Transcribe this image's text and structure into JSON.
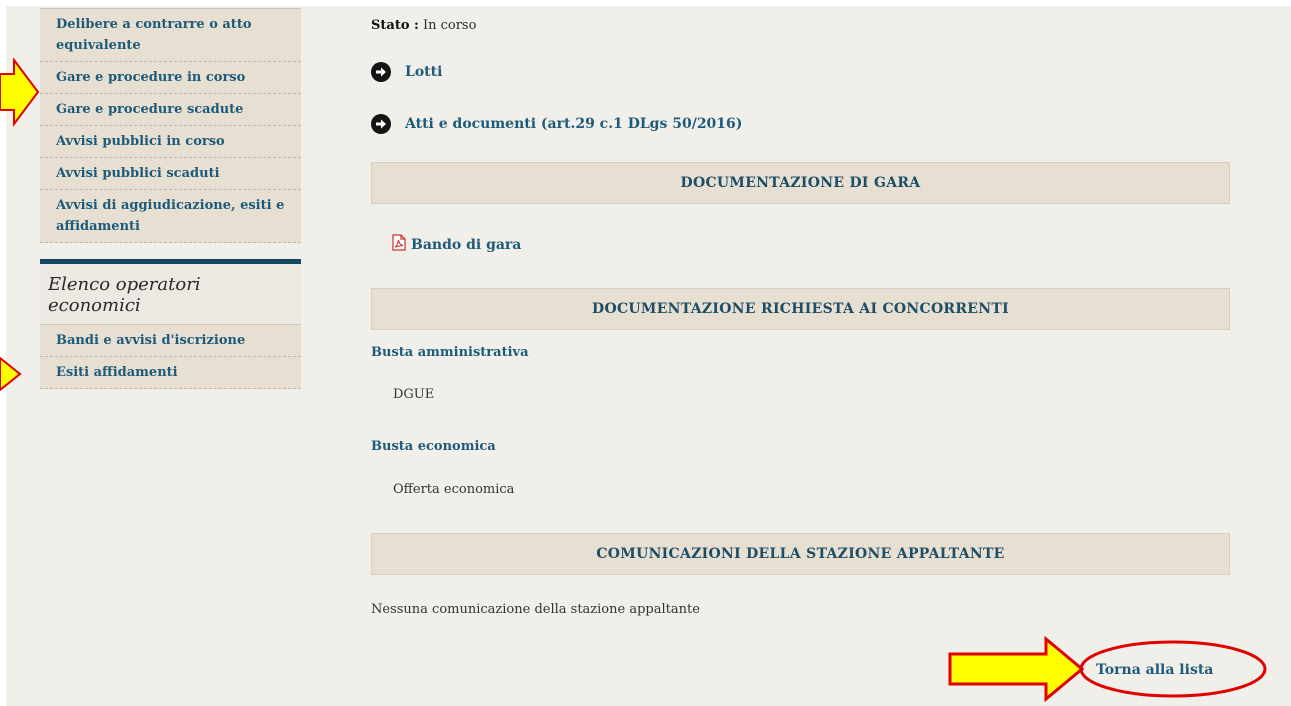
{
  "sidebar": {
    "items": [
      {
        "label": "Delibere a contrarre o atto equivalente"
      },
      {
        "label": "Gare e procedure in corso"
      },
      {
        "label": "Gare e procedure scadute"
      },
      {
        "label": "Avvisi pubblici in corso"
      },
      {
        "label": "Avvisi pubblici scaduti"
      },
      {
        "label": "Avvisi di aggiudicazione, esiti e affidamenti"
      }
    ],
    "section_title": "Elenco operatori economici",
    "section_items": [
      {
        "label": "Bandi e avvisi d'iscrizione"
      },
      {
        "label": "Esiti affidamenti"
      }
    ]
  },
  "main": {
    "status_label": "Stato :",
    "status_value": "In corso",
    "links": [
      {
        "label": "Lotti",
        "icon": "arrow-right-circle-icon"
      },
      {
        "label": "Atti e documenti (art.29 c.1 DLgs 50/2016)",
        "icon": "arrow-right-circle-icon"
      }
    ],
    "panels": {
      "doc_gara": "DOCUMENTAZIONE DI GARA",
      "doc_richiesta": "DOCUMENTAZIONE RICHIESTA AI CONCORRENTI",
      "comunicazioni": "COMUNICAZIONI DELLA STAZIONE APPALTANTE"
    },
    "bando_link": {
      "label": "Bando di gara",
      "icon": "pdf-icon"
    },
    "busta_amministrativa": {
      "title": "Busta amministrativa",
      "item": "DGUE"
    },
    "busta_economica": {
      "title": "Busta economica",
      "item": "Offerta economica"
    },
    "comunicazioni_text": "Nessuna comunicazione della stazione appaltante",
    "back_link": "Torna alla lista"
  },
  "colors": {
    "link": "#1e5a7a",
    "sidebar_bg": "#e6dfd2",
    "page_bg": "#f1efe9",
    "annotation_arrow": "#ffff00",
    "annotation_outline": "#e00000"
  }
}
